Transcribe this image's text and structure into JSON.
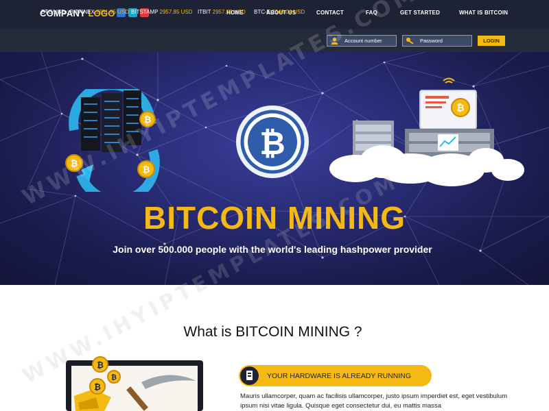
{
  "header": {
    "logo_main": "COMPANY",
    "logo_accent": "LOGO",
    "social_icons": [
      "facebook-icon",
      "vimeo-icon",
      "pinterest-icon"
    ],
    "nav": [
      "HOME",
      "ABOUT US",
      "CONTACT",
      "FAQ",
      "GET STARTED",
      "WHAT IS BITCOIN"
    ]
  },
  "ticker": {
    "items": [
      {
        "label": "BTC/USD : BITFINEX",
        "value": "2951.95 USD"
      },
      {
        "label": "BITSTAMP",
        "value": "2957.85 USD"
      },
      {
        "label": "ITBIT",
        "value": "2957.85 USD"
      },
      {
        "label": "BTC-E",
        "value": "2946.04 USD"
      }
    ],
    "account_placeholder": "Account number",
    "password_placeholder": "Password",
    "login_label": "LOGIN"
  },
  "hero": {
    "title": "BITCOIN MINING",
    "subtitle": "Join over 500.000 people with the world's leading hashpower provider"
  },
  "about": {
    "title": "What is BITCOIN MINING ?",
    "feature_label": "YOUR HARDWARE IS ALREADY RUNNING",
    "feature_text": "Mauris ullamcorper, quam ac facilisis ullamcorper, justo ipsum imperdiet est, eget vestibulum ipsum nisi vitae ligula. Quisque eget consectetur dui, eu mattis massa"
  },
  "watermark": "WWW.IHYIPTEMPLATES.COM",
  "colors": {
    "accent": "#f5b914",
    "nav_bg": "#1d2235",
    "ticker_bg": "#262b3c",
    "hero_dark": "#1b1c4e"
  }
}
